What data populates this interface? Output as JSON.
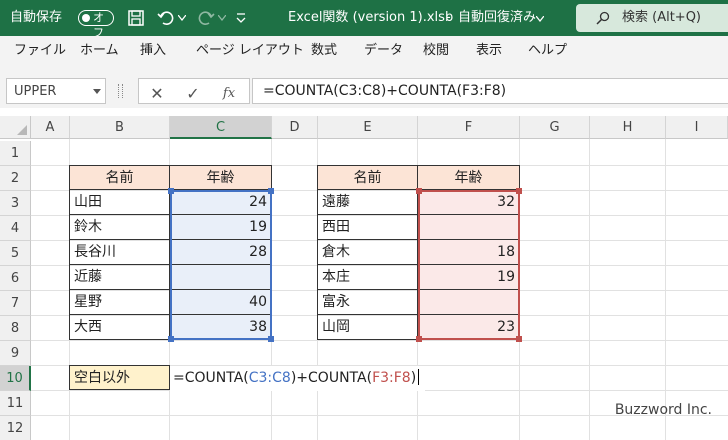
{
  "titlebar": {
    "autosave_label": "自動保存",
    "autosave_state": "オフ",
    "document_title": "Excel関数 (version 1).xlsb",
    "save_status": "自動回復済み",
    "search_label": "検索 (Alt+Q)",
    "icons": [
      "save-icon",
      "undo-icon",
      "redo-icon",
      "customize-icon",
      "search-icon"
    ]
  },
  "menu": {
    "items": [
      "ファイル",
      "ホーム",
      "挿入",
      "ページ レイアウト",
      "数式",
      "データ",
      "校閲",
      "表示",
      "ヘルプ"
    ]
  },
  "formula_bar": {
    "name_box": "UPPER",
    "cancel": "✕",
    "enter": "✓",
    "fx": "fx",
    "formula": "=COUNTA(C3:C8)+COUNTA(F3:F8)"
  },
  "grid": {
    "columns": [
      "A",
      "B",
      "C",
      "D",
      "E",
      "F",
      "G",
      "H",
      "I"
    ],
    "rows": [
      "1",
      "2",
      "3",
      "4",
      "5",
      "6",
      "7",
      "8",
      "9",
      "10",
      "11",
      "12"
    ],
    "selected_column": "C",
    "selected_row": "10"
  },
  "table1": {
    "header_name": "名前",
    "header_age": "年齢",
    "rows": [
      {
        "name": "山田",
        "age": "24"
      },
      {
        "name": "鈴木",
        "age": "19"
      },
      {
        "name": "長谷川",
        "age": "28"
      },
      {
        "name": "近藤",
        "age": ""
      },
      {
        "name": "星野",
        "age": "40"
      },
      {
        "name": "大西",
        "age": "38"
      }
    ]
  },
  "table2": {
    "header_name": "名前",
    "header_age": "年齢",
    "rows": [
      {
        "name": "遠藤",
        "age": "32"
      },
      {
        "name": "西田",
        "age": ""
      },
      {
        "name": "倉木",
        "age": "18"
      },
      {
        "name": "本庄",
        "age": "19"
      },
      {
        "name": "富永",
        "age": ""
      },
      {
        "name": "山岡",
        "age": "23"
      }
    ]
  },
  "summary": {
    "label": "空白以外",
    "edit_prefix": "=COUNTA(",
    "range1": "C3:C8",
    "middle": ")+COUNTA(",
    "range2": "F3:F8",
    "suffix": ")"
  },
  "colors": {
    "excel_green": "#217346",
    "range1_color": "#4472c4",
    "range2_color": "#c0504d",
    "header_fill": "#fce4d6",
    "label_fill": "#fff2cc"
  },
  "watermark": "Buzzword Inc."
}
